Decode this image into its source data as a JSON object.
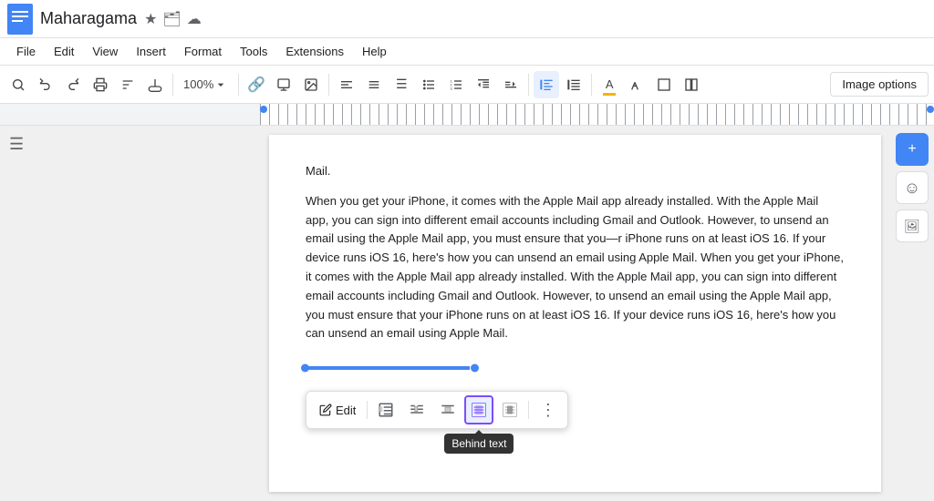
{
  "titleBar": {
    "docTitle": "Maharagama",
    "starLabel": "★",
    "folderLabel": "🗂",
    "cloudLabel": "☁"
  },
  "menuBar": {
    "items": [
      "File",
      "Edit",
      "View",
      "Insert",
      "Format",
      "Tools",
      "Extensions",
      "Help"
    ]
  },
  "toolbar": {
    "zoom": "100%",
    "imageOptionsLabel": "Image options"
  },
  "ruler": {},
  "document": {
    "paragraphs": [
      "Mail.",
      "When you get your iPhone, it comes with the Apple Mail app already installed. With the Apple Mail app, you can sign into different email accounts including Gmail and Outlook. However, to unsend an email using the Apple Mail app, you must ensure that you—r iPhone runs on at least iOS 16. If your device runs iOS 16, here's how you can unsend an email using Apple Mail. When you get your iPhone, it comes with the Apple Mail app already installed. With the Apple Mail app, you can sign into different email accounts including Gmail and Outlook. However, to unsend an email using the Apple Mail app, you must ensure that your iPhone runs on at least iOS 16. If your device runs iOS 16, here's how you can unsend an email using Apple Mail."
    ]
  },
  "imageToolbar": {
    "editLabel": "Edit",
    "tooltipText": "Behind text",
    "buttons": [
      {
        "name": "inline-wrap",
        "icon": "⬜",
        "label": "Inline wrap"
      },
      {
        "name": "wrap-text",
        "icon": "▦",
        "label": "Wrap text"
      },
      {
        "name": "break-text",
        "icon": "▩",
        "label": "Break text"
      },
      {
        "name": "behind-text",
        "icon": "▣",
        "label": "Behind text",
        "active": true
      },
      {
        "name": "in-front-text",
        "icon": "▤",
        "label": "In front of text"
      },
      {
        "name": "more-options",
        "icon": "⋮",
        "label": "More options"
      }
    ]
  },
  "rightPanel": {
    "buttons": [
      {
        "name": "add-btn",
        "icon": "+"
      },
      {
        "name": "emoji-btn",
        "icon": "☺"
      },
      {
        "name": "image-btn",
        "icon": "🖼"
      }
    ]
  }
}
